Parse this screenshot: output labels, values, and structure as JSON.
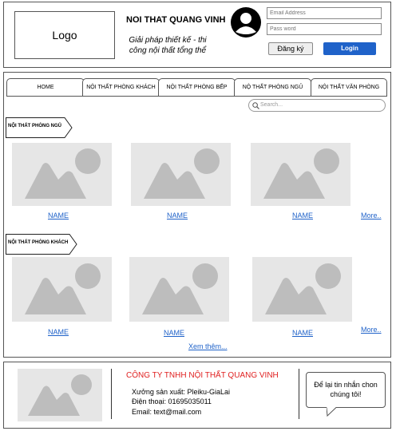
{
  "header": {
    "logo": "Logo",
    "brand": "NOI THAT QUANG VINH",
    "slogan": "Giải pháp thiết kế - thi công nội thất tổng thể",
    "email_placeholder": "Email Address",
    "password_placeholder": "Pass word",
    "register_label": "Đăng ký",
    "login_label": "Login",
    "brand_color": "#1f62c9"
  },
  "nav": {
    "tabs": [
      "HOME",
      "NỘI THẤT PHÒNG KHÁCH",
      "NỘI THẤT PHÒNG BẾP",
      "NỘ THẤT PHÒNG NGỦ",
      "NỘI THẤT VĂN PHÒNG"
    ]
  },
  "search": {
    "placeholder": "Search..."
  },
  "sections": [
    {
      "title": "NỘI THẤT PHÒNG NGỦ",
      "items": [
        "NAME",
        "NAME",
        "NAME"
      ],
      "more": "More.."
    },
    {
      "title": "NỘI THẤT PHÒNG KHÁCH",
      "items": [
        "NAME",
        "NAME",
        "NAME"
      ],
      "more": "More.."
    }
  ],
  "see_more": "Xem thêm...",
  "footer": {
    "company": "CÔNG TY TNHH NỘI THẤT QUANG VINH",
    "workshop": "Xưởng sản xuất: Pleiku-GiaLai",
    "phone": "Điện thoại: 01695035011",
    "email": "Email: text@mail.com",
    "message": "Để lại tin nhắn chon chúng tôi!",
    "company_color": "#e02020"
  }
}
